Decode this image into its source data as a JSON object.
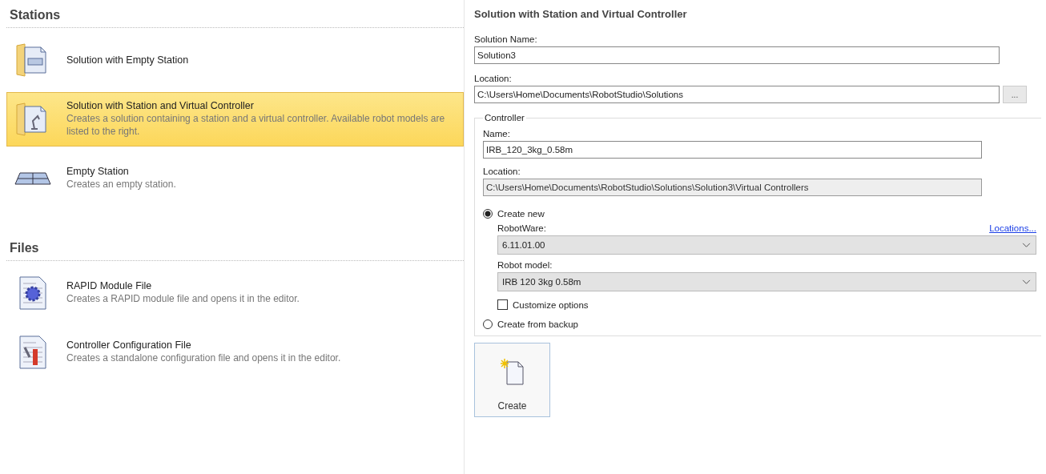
{
  "sections": [
    {
      "title": "Stations",
      "items": [
        {
          "kind": "solution-empty",
          "title": "Solution with Empty Station",
          "selected": false
        },
        {
          "kind": "solution-controller",
          "title": "Solution with Station and Virtual Controller",
          "description": "Creates a solution containing a station and a virtual controller. Available robot models are listed to the right.",
          "selected": true
        },
        {
          "kind": "station",
          "title": "Empty Station",
          "description": "Creates an empty station.",
          "selected": false
        }
      ]
    },
    {
      "title": "Files",
      "items": [
        {
          "kind": "module",
          "title": "RAPID Module File",
          "description": "Creates a RAPID module file and opens it in the editor.",
          "selected": false
        },
        {
          "kind": "config",
          "title": "Controller Configuration File",
          "description": "Creates a standalone configuration file and opens it in the editor.",
          "selected": false
        }
      ]
    }
  ],
  "details": {
    "title": "Solution with Station and Virtual Controller",
    "solution_name": {
      "label": "Solution Name:",
      "value": "Solution3"
    },
    "location": {
      "label": "Location:",
      "value": "C:\\Users\\Home\\Documents\\RobotStudio\\Solutions",
      "browse": "..."
    },
    "controller": {
      "legend": "Controller",
      "name": {
        "label": "Name:",
        "value": "IRB_120_3kg_0.58m"
      },
      "location": {
        "label": "Location:",
        "value": "C:\\Users\\Home\\Documents\\RobotStudio\\Solutions\\Solution3\\Virtual Controllers",
        "disabled": true
      },
      "create_new": {
        "label": "Create new",
        "selected": true
      },
      "robotware": {
        "label": "RobotWare:",
        "link": "Locations...",
        "value": "6.11.01.00"
      },
      "robot_model": {
        "label": "Robot model:",
        "value": "IRB 120 3kg 0.58m"
      },
      "customize": {
        "label": "Customize options",
        "checked": false
      },
      "create_from_backup": {
        "label": "Create from backup",
        "selected": false
      }
    },
    "create_button": "Create"
  }
}
